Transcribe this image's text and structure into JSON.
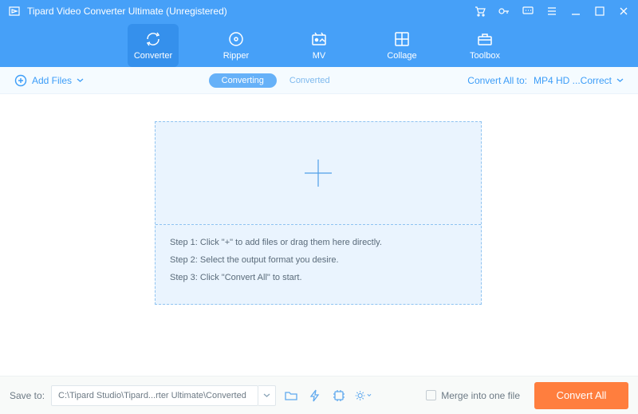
{
  "titlebar": {
    "title": "Tipard Video Converter Ultimate (Unregistered)"
  },
  "nav": {
    "converter": "Converter",
    "ripper": "Ripper",
    "mv": "MV",
    "collage": "Collage",
    "toolbox": "Toolbox"
  },
  "subbar": {
    "addfiles": "Add Files",
    "converting": "Converting",
    "converted": "Converted",
    "convertAllLabel": "Convert All to:",
    "format": "MP4 HD ...Correct"
  },
  "steps": {
    "s1": "Step 1: Click \"+\" to add files or drag them here directly.",
    "s2": "Step 2: Select the output format you desire.",
    "s3": "Step 3: Click \"Convert All\" to start."
  },
  "bottom": {
    "saveto": "Save to:",
    "path": "C:\\Tipard Studio\\Tipard...rter Ultimate\\Converted",
    "merge": "Merge into one file",
    "convertAll": "Convert All"
  }
}
